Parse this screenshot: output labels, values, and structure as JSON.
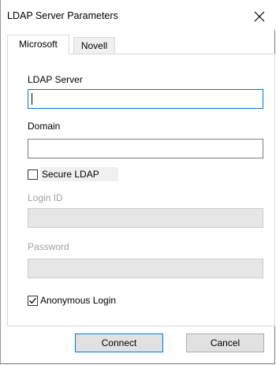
{
  "window": {
    "title": "LDAP Server Parameters"
  },
  "tabs": [
    {
      "label": "Microsoft",
      "active": true
    },
    {
      "label": "Novell",
      "active": false
    }
  ],
  "form": {
    "ldap_server": {
      "label": "LDAP Server",
      "value": ""
    },
    "domain": {
      "label": "Domain",
      "value": ""
    },
    "secure_ldap": {
      "label": "Secure LDAP",
      "checked": false
    },
    "login_id": {
      "label": "Login ID",
      "value": "",
      "disabled": true
    },
    "password": {
      "label": "Password",
      "value": "",
      "disabled": true
    },
    "anonymous_login": {
      "label": "Anonymous Login",
      "checked": true
    }
  },
  "buttons": {
    "connect": "Connect",
    "cancel": "Cancel"
  },
  "colors": {
    "focus": "#0078d7",
    "disabled_fill": "#e6e6e6",
    "button_face": "#e1e1e1"
  }
}
